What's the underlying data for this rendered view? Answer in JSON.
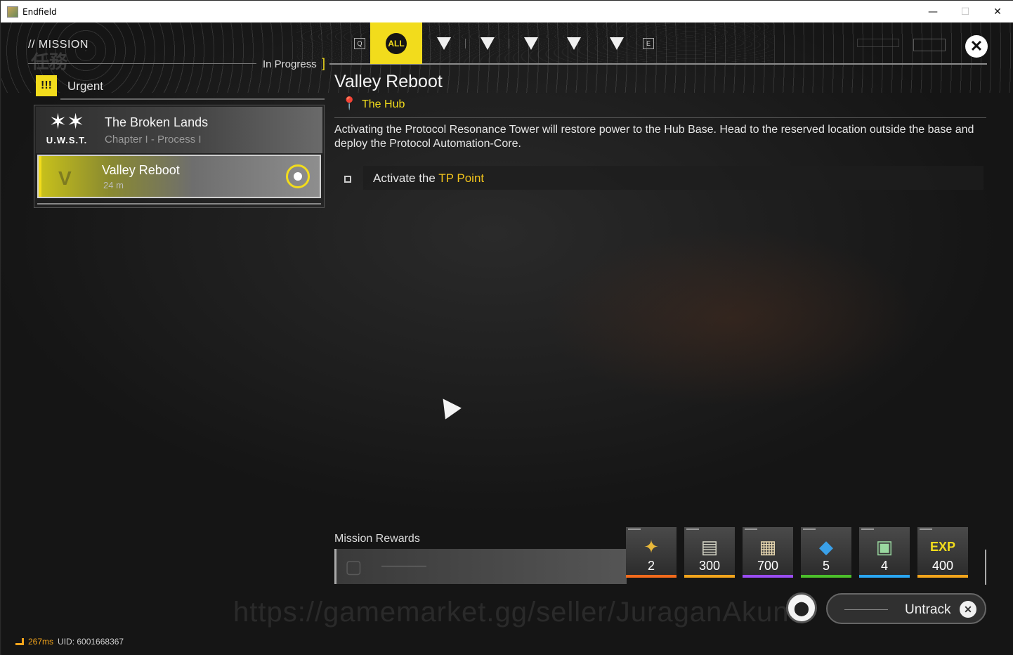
{
  "window": {
    "title": "Endfield",
    "minimize": "—",
    "maximize": "☐",
    "close": "✕"
  },
  "header": {
    "mission_label": "// MISSION",
    "in_progress": "In Progress",
    "bracket": "]",
    "tabs": [
      {
        "name": "Q",
        "type": "key"
      },
      {
        "name": "ALL",
        "type": "all"
      },
      {
        "name": "main",
        "type": "icon"
      },
      {
        "name": "side",
        "type": "icon"
      },
      {
        "name": "event",
        "type": "icon"
      },
      {
        "name": "daily",
        "type": "icon"
      },
      {
        "name": "other",
        "type": "icon"
      },
      {
        "name": "E",
        "type": "key"
      }
    ],
    "close_icon": "✕"
  },
  "sidebar": {
    "urgent_badge": "!!!",
    "urgent_label": "Urgent",
    "chapter": {
      "name": "The Broken Lands",
      "subtitle": "Chapter I - Process I",
      "logo_text": "U.W.S.T."
    },
    "mission": {
      "name": "Valley Reboot",
      "distance": "24 m"
    }
  },
  "detail": {
    "title": "Valley Reboot",
    "location_icon": "📍",
    "location": "The Hub",
    "description": "Activating the Protocol Resonance Tower will restore power to the Hub Base. Head to the reserved location outside the base and deploy the Protocol Automation-Core.",
    "objective": {
      "prefix": "Activate the ",
      "highlight": "TP Point"
    }
  },
  "rewards": {
    "label": "Mission Rewards",
    "items": [
      {
        "icon": "gold-crystal-icon",
        "glyph": "✦",
        "qty": "2",
        "accent": "#f26a1c"
      },
      {
        "icon": "ticket-icon",
        "glyph": "▤",
        "qty": "300",
        "accent": "#f2a41c"
      },
      {
        "icon": "currency-notes-icon",
        "glyph": "▦",
        "qty": "700",
        "accent": "#9a4cf2"
      },
      {
        "icon": "exp-card-icon",
        "glyph": "◆",
        "qty": "5",
        "accent": "#4cbf2a"
      },
      {
        "icon": "module-icon",
        "glyph": "▣",
        "qty": "4",
        "accent": "#2aa6f2"
      },
      {
        "icon": "exp-icon",
        "glyph": "EXP",
        "qty": "400",
        "accent": "#f2a41c"
      }
    ]
  },
  "footer": {
    "watermark": "https://gamemarket.gg/seller/JuraganAkun",
    "untrack": "Untrack",
    "ping": "267ms",
    "uid": "UID: 6001668367"
  }
}
